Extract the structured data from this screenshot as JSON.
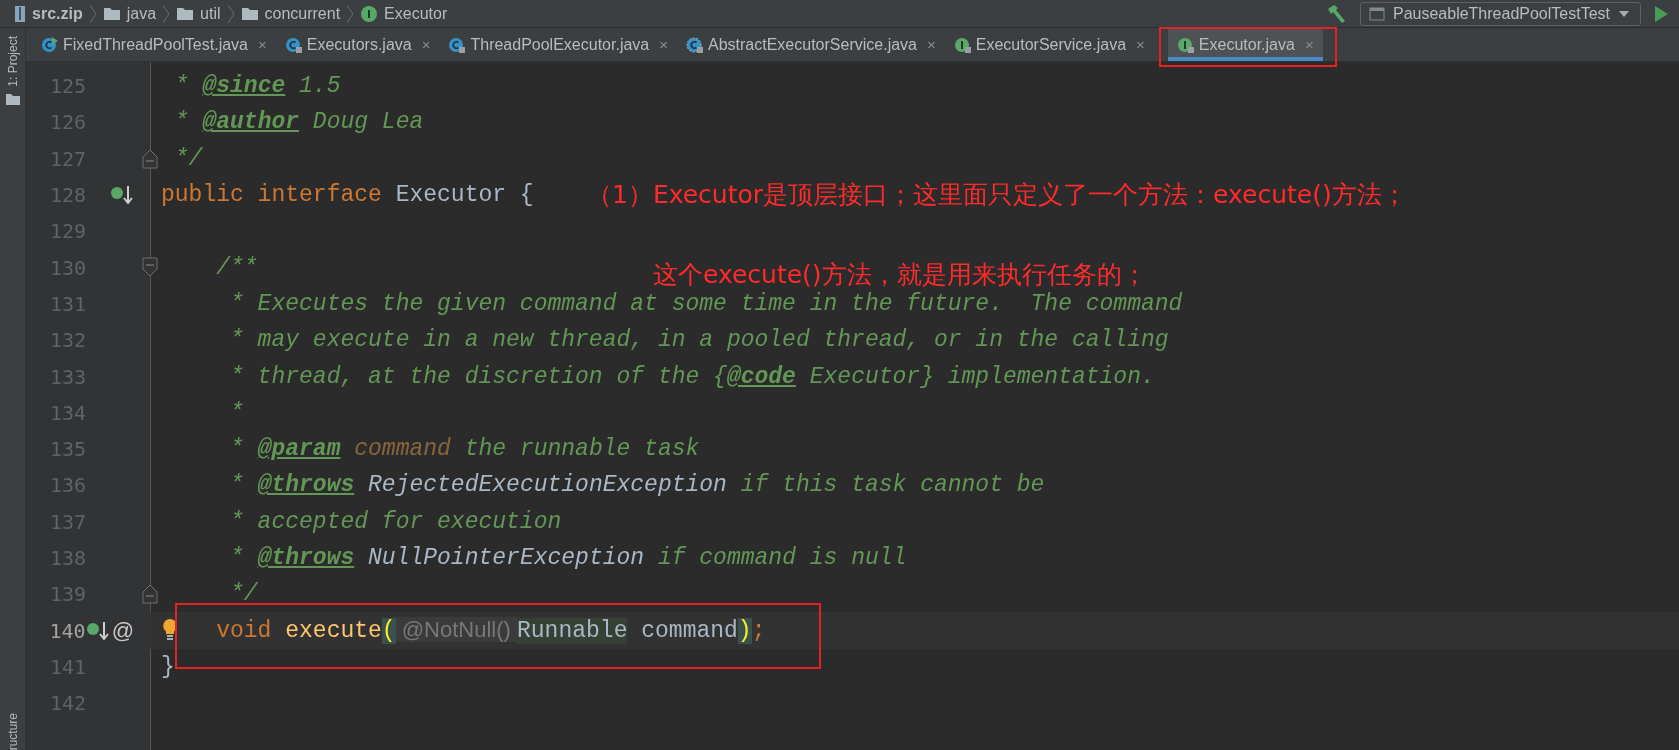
{
  "breadcrumb": [
    {
      "label": "src.zip",
      "kind": "archive"
    },
    {
      "label": "java",
      "kind": "folder"
    },
    {
      "label": "util",
      "kind": "folder"
    },
    {
      "label": "concurrent",
      "kind": "folder"
    },
    {
      "label": "Executor",
      "kind": "interface"
    }
  ],
  "run_config": {
    "label": "PauseableThreadPoolTestTest"
  },
  "side_strip": {
    "top_label": "1: Project",
    "bottom_label": "ructure"
  },
  "tabs": [
    {
      "label": "FixedThreadPoolTest.java",
      "kind": "runnable-class",
      "close": "×",
      "selected": false
    },
    {
      "label": "Executors.java",
      "kind": "class",
      "close": "×",
      "selected": false
    },
    {
      "label": "ThreadPoolExecutor.java",
      "kind": "class",
      "close": "×",
      "selected": false
    },
    {
      "label": "AbstractExecutorService.java",
      "kind": "abstract-class",
      "close": "×",
      "selected": false
    },
    {
      "label": "ExecutorService.java",
      "kind": "interface",
      "close": "×",
      "selected": false
    },
    {
      "label": "Executor.java",
      "kind": "interface",
      "close": "×",
      "selected": true
    }
  ],
  "lines": [
    {
      "number": "125",
      "tokens": [
        {
          "t": " * ",
          "kind": "doc"
        },
        {
          "t": "@since",
          "kind": "doctag"
        },
        {
          "t": " 1.5",
          "kind": "doc"
        }
      ]
    },
    {
      "number": "126",
      "tokens": [
        {
          "t": " * ",
          "kind": "doc"
        },
        {
          "t": "@author",
          "kind": "doctag"
        },
        {
          "t": " Doug Lea",
          "kind": "doc"
        }
      ]
    },
    {
      "number": "127",
      "fold": {
        "kind": "end"
      },
      "tokens": [
        {
          "t": " */",
          "kind": "doc"
        }
      ]
    },
    {
      "number": "128",
      "gutter": [
        {
          "kind": "implemented"
        }
      ],
      "tokens": [
        {
          "t": "public interface ",
          "kind": "keyword"
        },
        {
          "t": "Executor {",
          "kind": "plain"
        }
      ]
    },
    {
      "number": "129"
    },
    {
      "number": "130",
      "fold": {
        "kind": "start"
      },
      "tokens": [
        {
          "t": "    /**",
          "kind": "doc"
        }
      ]
    },
    {
      "number": "131",
      "tokens": [
        {
          "t": "     * Executes the given command at some time in the future.  The command",
          "kind": "doc"
        }
      ]
    },
    {
      "number": "132",
      "tokens": [
        {
          "t": "     * may execute in a new thread, in a pooled thread, or in the calling",
          "kind": "doc"
        }
      ]
    },
    {
      "number": "133",
      "tokens": [
        {
          "t": "     * thread, at the discretion of the {",
          "kind": "doc"
        },
        {
          "t": "@code",
          "kind": "doctag"
        },
        {
          "t": " Executor} implementation.",
          "kind": "doc"
        }
      ]
    },
    {
      "number": "134",
      "tokens": [
        {
          "t": "     *",
          "kind": "doc"
        }
      ]
    },
    {
      "number": "135",
      "tokens": [
        {
          "t": "     * ",
          "kind": "doc"
        },
        {
          "t": "@param",
          "kind": "doctag"
        },
        {
          "t": " command",
          "kind": "docparam"
        },
        {
          "t": " the runnable task",
          "kind": "doc"
        }
      ]
    },
    {
      "number": "136",
      "tokens": [
        {
          "t": "     * ",
          "kind": "doc"
        },
        {
          "t": "@throws",
          "kind": "doctag"
        },
        {
          "t": " RejectedExecutionException",
          "kind": "docclass"
        },
        {
          "t": " if this task cannot be",
          "kind": "doc"
        }
      ]
    },
    {
      "number": "137",
      "tokens": [
        {
          "t": "     * accepted for execution",
          "kind": "doc"
        }
      ]
    },
    {
      "number": "138",
      "tokens": [
        {
          "t": "     * ",
          "kind": "doc"
        },
        {
          "t": "@throws",
          "kind": "doctag"
        },
        {
          "t": " NullPointerException",
          "kind": "docclass"
        },
        {
          "t": " if command is null",
          "kind": "doc"
        }
      ]
    },
    {
      "number": "139",
      "fold": {
        "kind": "end"
      },
      "tokens": [
        {
          "t": "     */",
          "kind": "doc"
        }
      ]
    },
    {
      "number": "140",
      "current": true,
      "bulb": true,
      "gutter": [
        {
          "kind": "implemented"
        }
      ],
      "gutter_mark": "@",
      "tokens": [
        {
          "t": "    void ",
          "kind": "keyword"
        },
        {
          "t": "execute",
          "kind": "method"
        },
        {
          "t": "(",
          "kind": "brace"
        },
        {
          "t": " @NotNull() ",
          "kind": "hint"
        },
        {
          "t": "Runnable",
          "kind": "usage"
        },
        {
          "t": " command",
          "kind": "plain"
        },
        {
          "t": ")",
          "kind": "brace"
        },
        {
          "t": ";",
          "kind": "keyword"
        }
      ]
    },
    {
      "number": "141",
      "tokens": [
        {
          "t": "}",
          "kind": "plain"
        }
      ]
    },
    {
      "number": "142"
    }
  ],
  "notes": [
    {
      "text": "（1）Executor是顶层接口；这里面只定义了一个方法：execute()方法；"
    },
    {
      "text": "这个execute()方法，就是用来执行任务的；"
    }
  ]
}
